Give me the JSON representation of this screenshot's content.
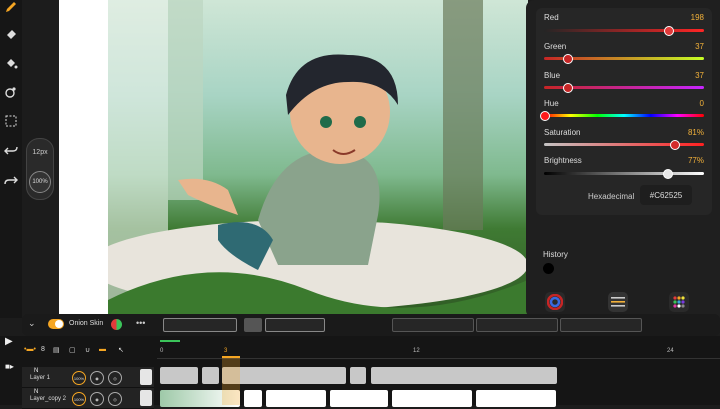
{
  "toolbar": {
    "tools": [
      "pencil-icon",
      "eraser-icon",
      "fill-bucket-icon",
      "eyedropper-icon",
      "lasso-select-icon",
      "undo-icon",
      "redo-icon"
    ]
  },
  "brush": {
    "size_label": "12px",
    "opacity_label": "100%"
  },
  "color_panel": {
    "sliders": [
      {
        "name": "Red",
        "value": "198",
        "level": 0.776
      },
      {
        "name": "Green",
        "value": "37",
        "level": 0.145
      },
      {
        "name": "Blue",
        "value": "37",
        "level": 0.145
      },
      {
        "name": "Hue",
        "value": "0",
        "level": 0.0
      },
      {
        "name": "Saturation",
        "value": "81%",
        "level": 0.81
      },
      {
        "name": "Brightness",
        "value": "77%",
        "level": 0.77
      }
    ],
    "hex_label": "Hexadecimal",
    "hex_value": "#C62525",
    "history_label": "History",
    "accent": "#f2b13a"
  },
  "onion": {
    "label": "Onion Skin",
    "more": "•••"
  },
  "timeline": {
    "ruler_labels": [
      "0",
      "3",
      "12",
      "24"
    ],
    "layer_count": "8",
    "layers": [
      {
        "name": "Layer 1",
        "letter": "N",
        "opacity": "100%"
      },
      {
        "name": "Layer_copy 2",
        "letter": "N",
        "opacity": "100%"
      }
    ]
  }
}
